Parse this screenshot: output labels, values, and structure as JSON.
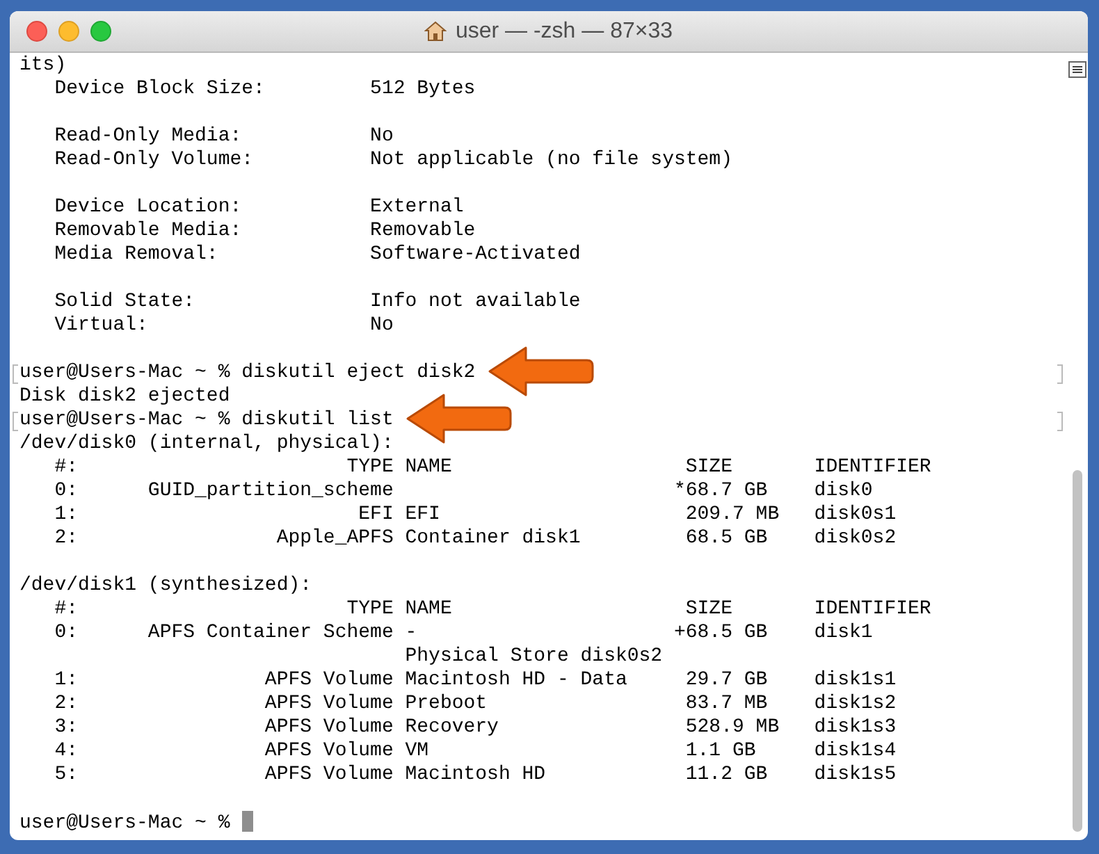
{
  "window": {
    "title": "user — -zsh — 87×33"
  },
  "lines": [
    {
      "kind": "output",
      "text": "its)"
    },
    {
      "kind": "output",
      "text": "   Device Block Size:         512 Bytes"
    },
    {
      "kind": "blank"
    },
    {
      "kind": "output",
      "text": "   Read-Only Media:           No"
    },
    {
      "kind": "output",
      "text": "   Read-Only Volume:          Not applicable (no file system)"
    },
    {
      "kind": "blank"
    },
    {
      "kind": "output",
      "text": "   Device Location:           External"
    },
    {
      "kind": "output",
      "text": "   Removable Media:           Removable"
    },
    {
      "kind": "output",
      "text": "   Media Removal:             Software-Activated"
    },
    {
      "kind": "blank"
    },
    {
      "kind": "output",
      "text": "   Solid State:               Info not available"
    },
    {
      "kind": "output",
      "text": "   Virtual:                   No"
    },
    {
      "kind": "blank"
    },
    {
      "kind": "prompt",
      "text": "user@Users-Mac ~ % diskutil eject disk2",
      "marked": true,
      "arrow": true,
      "cursor": false
    },
    {
      "kind": "output",
      "text": "Disk disk2 ejected"
    },
    {
      "kind": "prompt",
      "text": "user@Users-Mac ~ % diskutil list",
      "marked": true,
      "arrow": true,
      "cursor": false
    },
    {
      "kind": "output",
      "text": "/dev/disk0 (internal, physical):"
    },
    {
      "kind": "output",
      "text": "   #:                       TYPE NAME                    SIZE       IDENTIFIER"
    },
    {
      "kind": "output",
      "text": "   0:      GUID_partition_scheme                        *68.7 GB    disk0"
    },
    {
      "kind": "output",
      "text": "   1:                        EFI EFI                     209.7 MB   disk0s1"
    },
    {
      "kind": "output",
      "text": "   2:                 Apple_APFS Container disk1         68.5 GB    disk0s2"
    },
    {
      "kind": "blank"
    },
    {
      "kind": "output",
      "text": "/dev/disk1 (synthesized):"
    },
    {
      "kind": "output",
      "text": "   #:                       TYPE NAME                    SIZE       IDENTIFIER"
    },
    {
      "kind": "output",
      "text": "   0:      APFS Container Scheme -                      +68.5 GB    disk1"
    },
    {
      "kind": "output",
      "text": "                                 Physical Store disk0s2"
    },
    {
      "kind": "output",
      "text": "   1:                APFS Volume Macintosh HD - Data     29.7 GB    disk1s1"
    },
    {
      "kind": "output",
      "text": "   2:                APFS Volume Preboot                 83.7 MB    disk1s2"
    },
    {
      "kind": "output",
      "text": "   3:                APFS Volume Recovery                528.9 MB   disk1s3"
    },
    {
      "kind": "output",
      "text": "   4:                APFS Volume VM                      1.1 GB     disk1s4"
    },
    {
      "kind": "output",
      "text": "   5:                APFS Volume Macintosh HD            11.2 GB    disk1s5"
    },
    {
      "kind": "blank"
    },
    {
      "kind": "prompt",
      "text": "user@Users-Mac ~ % ",
      "marked": false,
      "arrow": false,
      "cursor": true
    }
  ]
}
